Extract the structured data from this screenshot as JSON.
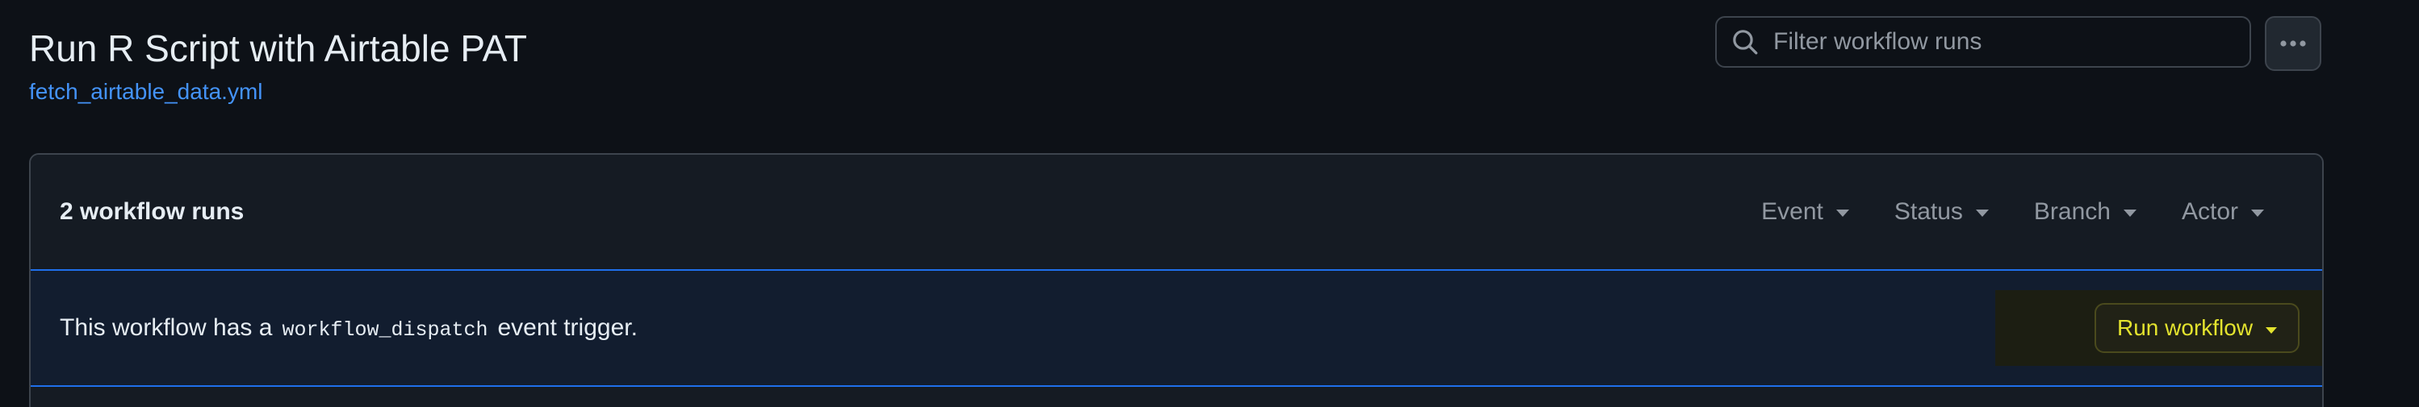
{
  "header": {
    "title": "Run R Script with Airtable PAT",
    "workflow_file": "fetch_airtable_data.yml"
  },
  "search": {
    "placeholder": "Filter workflow runs",
    "value": "",
    "icon": "search-icon"
  },
  "more_menu": {
    "icon": "kebab-horizontal-icon"
  },
  "runs_panel": {
    "count_label": "2 workflow runs",
    "filters": [
      {
        "label": "Event"
      },
      {
        "label": "Status"
      },
      {
        "label": "Branch"
      },
      {
        "label": "Actor"
      }
    ],
    "dispatch": {
      "prefix": "This workflow has a",
      "code": "workflow_dispatch",
      "suffix": "event trigger.",
      "run_button_label": "Run workflow"
    }
  },
  "colors": {
    "background": "#0d1117",
    "link": "#4493f8",
    "accent_border": "#1f6feb",
    "run_button_text": "#e3e32e"
  }
}
